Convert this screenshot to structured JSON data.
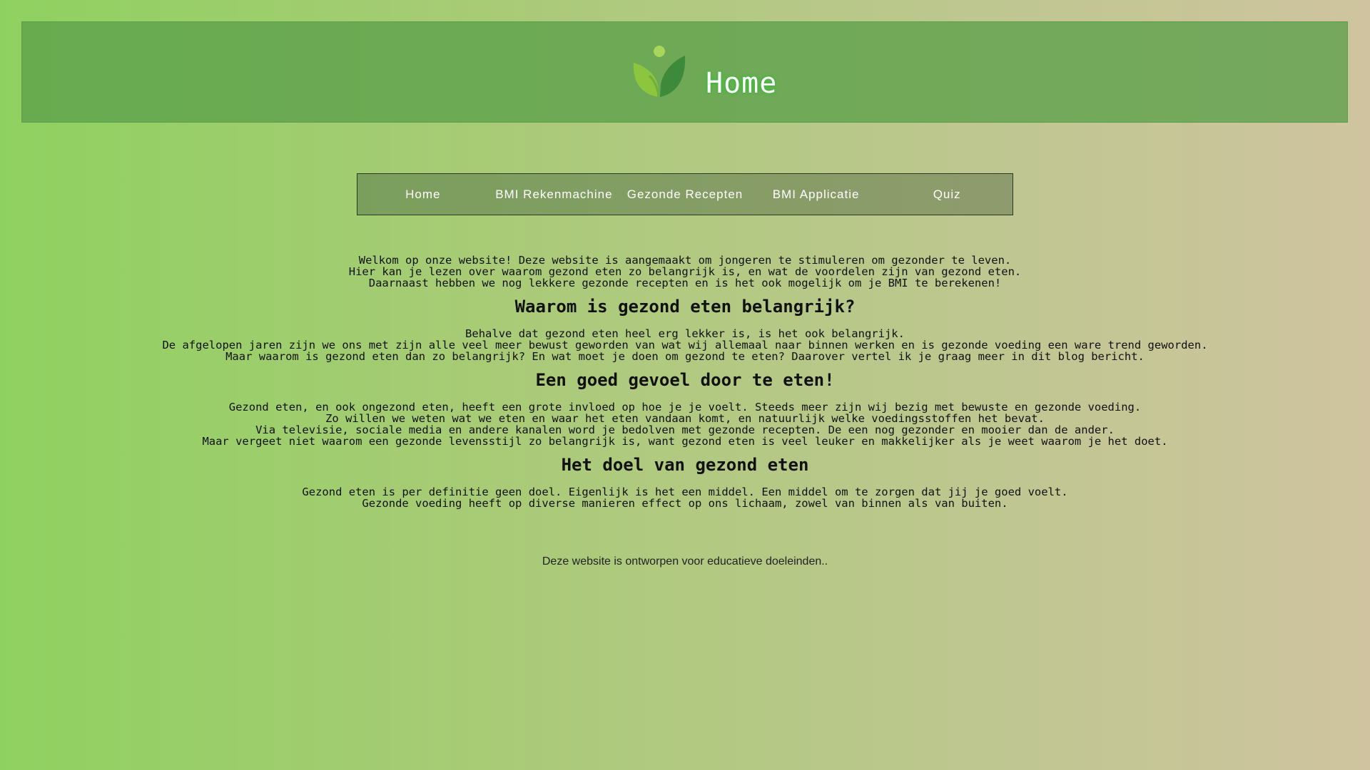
{
  "header": {
    "title": "Home",
    "logo_icon": "leaf-person-icon"
  },
  "nav": {
    "items": [
      {
        "label": "Home"
      },
      {
        "label": "BMI Rekenmachine"
      },
      {
        "label": "Gezonde Recepten"
      },
      {
        "label": "BMI Applicatie"
      },
      {
        "label": "Quiz"
      }
    ]
  },
  "intro": {
    "lines": [
      "Welkom op onze website! Deze website is aangemaakt om jongeren te stimuleren om gezonder te leven.",
      "Hier kan je lezen over waarom gezond eten zo belangrijk is, en wat de voordelen zijn van gezond eten.",
      "Daarnaast hebben we nog lekkere gezonde recepten en is het ook mogelijk om je BMI te berekenen!"
    ]
  },
  "sections": [
    {
      "heading": "Waarom is gezond eten belangrijk?",
      "lines": [
        "Behalve dat gezond eten heel erg lekker is, is het ook belangrijk.",
        "De afgelopen jaren zijn we ons met zijn alle veel meer bewust geworden van wat wij allemaal naar binnen werken en is gezonde voeding een ware trend geworden.",
        "Maar waarom is gezond eten dan zo belangrijk? En wat moet je doen om gezond te eten? Daarover vertel ik je graag meer in dit blog bericht."
      ]
    },
    {
      "heading": "Een goed gevoel door te eten!",
      "lines": [
        "Gezond eten, en ook ongezond eten, heeft een grote invloed op hoe je je voelt. Steeds meer zijn wij bezig met bewuste en gezonde voeding.",
        "Zo willen we weten wat we eten en waar het eten vandaan komt, en natuurlijk welke voedingsstoffen het bevat.",
        "Via televisie, sociale media en andere kanalen word je bedolven met gezonde recepten. De een nog gezonder en mooier dan de ander.",
        "Maar vergeet niet waarom een gezonde levensstijl zo belangrijk is, want gezond eten is veel leuker en makkelijker als je weet waarom je het doet."
      ]
    },
    {
      "heading": "Het doel van gezond eten",
      "lines": [
        "Gezond eten is per definitie geen doel. Eigenlijk is het een middel. Een middel om te zorgen dat jij je goed voelt.",
        "Gezonde voeding heeft op diverse manieren effect op ons lichaam, zowel van binnen als van buiten."
      ]
    }
  ],
  "footer": {
    "text": "Deze website is ontworpen voor educatieve doeleinden.."
  },
  "colors": {
    "header_bg": "#6fa85a",
    "title_glow": "#39c239",
    "nav_bg": "#83a062",
    "page_bg_start": "#8fd160",
    "page_bg_end": "#cfc49f"
  }
}
